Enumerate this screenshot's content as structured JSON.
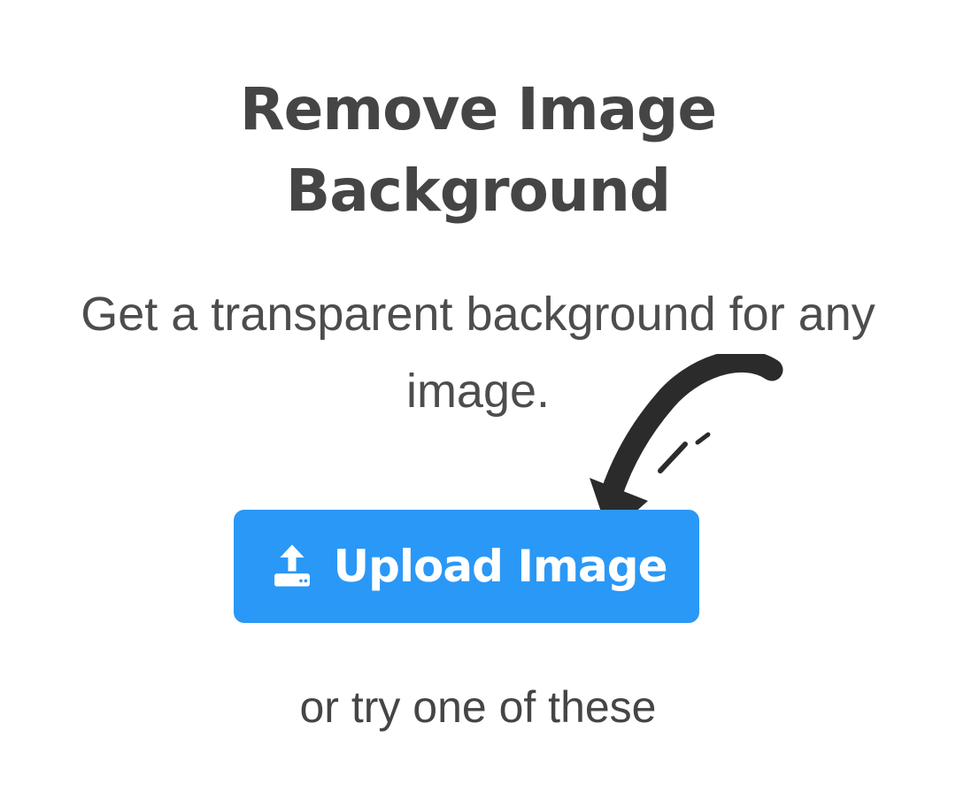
{
  "title": {
    "line1": "Remove Image",
    "line2": "Background"
  },
  "subtitle": {
    "line1": "Get a transparent background for any",
    "line2": "image."
  },
  "upload_button": {
    "label": "Upload Image",
    "icon": "upload-icon",
    "color": "#2a98f6"
  },
  "alternate_prompt": "or try one of these",
  "decoration": {
    "icon": "hand-drawn-arrow-icon",
    "color": "#2b2b2b"
  }
}
